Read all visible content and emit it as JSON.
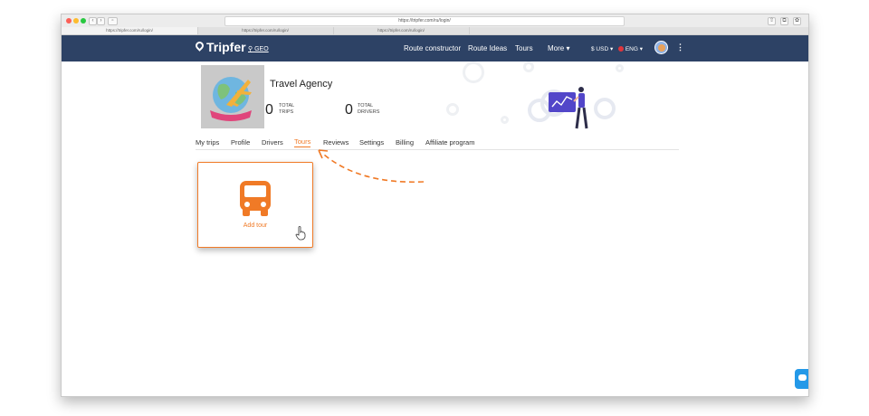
{
  "browser": {
    "url": "https://tripfer.com/ru/login/",
    "tabs": [
      "https://tripfer.com/ru/login/",
      "https://tripfer.com/ru/login/",
      "https://tripfer.com/ru/login/"
    ]
  },
  "nav": {
    "brand": "Tripfer",
    "location": "GEO",
    "links": [
      "Route constructor",
      "Route Ideas",
      "Tours",
      "More ▾"
    ],
    "currency": "$ USD ▾",
    "language": "ENG ▾",
    "kebab": "⋮"
  },
  "profile": {
    "name": "Travel Agency",
    "stats": [
      {
        "value": "0",
        "label_line1": "TOTAL",
        "label_line2": "TRIPS"
      },
      {
        "value": "0",
        "label_line1": "TOTAL",
        "label_line2": "DRIVERS"
      }
    ]
  },
  "tabs": [
    "My trips",
    "Profile",
    "Drivers",
    "Tours",
    "Reviews",
    "Settings",
    "Billing",
    "Affiliate program"
  ],
  "active_tab": "Tours",
  "add_tour": {
    "label": "Add tour"
  },
  "colors": {
    "nav": "#2d4265",
    "accent": "#f07a26",
    "chat": "#2499e8"
  },
  "icons": [
    "bus-icon",
    "hand-pointer-icon",
    "chat-icon",
    "location-pin-icon",
    "globe-airplane-icon"
  ]
}
